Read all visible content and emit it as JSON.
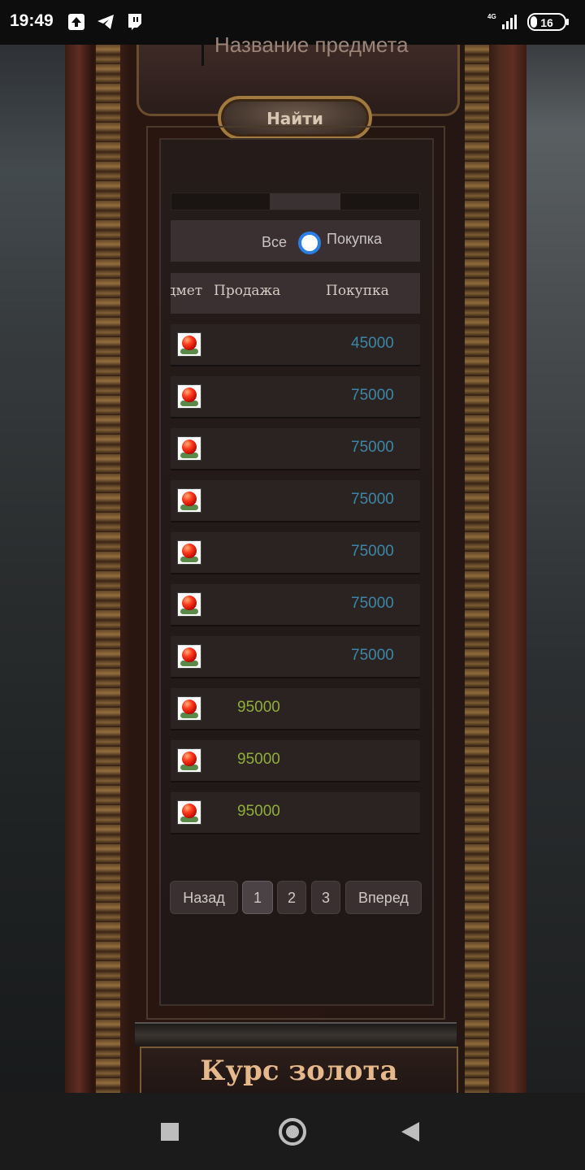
{
  "status_bar": {
    "time": "19:49",
    "network": "4G",
    "battery": "16"
  },
  "search": {
    "item_name_placeholder": "Название предмета",
    "find_button": "Найти"
  },
  "filter": {
    "all_label": "Все",
    "buy_label": "Покупка",
    "selected": "Все"
  },
  "table": {
    "headers": {
      "item": "дмет",
      "sell": "Продажа",
      "buy": "Покупка"
    },
    "rows": [
      {
        "sell": "",
        "buy": "45000"
      },
      {
        "sell": "",
        "buy": "75000"
      },
      {
        "sell": "",
        "buy": "75000"
      },
      {
        "sell": "",
        "buy": "75000"
      },
      {
        "sell": "",
        "buy": "75000"
      },
      {
        "sell": "",
        "buy": "75000"
      },
      {
        "sell": "",
        "buy": "75000"
      },
      {
        "sell": "95000",
        "buy": ""
      },
      {
        "sell": "95000",
        "buy": ""
      },
      {
        "sell": "95000",
        "buy": ""
      }
    ]
  },
  "pagination": {
    "prev": "Назад",
    "pages": [
      "1",
      "2",
      "3"
    ],
    "current": "1",
    "next": "Вперед"
  },
  "footer": {
    "title": "Курс золота"
  },
  "colors": {
    "sell_value": "#8fae3a",
    "buy_value": "#3d87a6",
    "radio_accent": "#2a7ee8"
  }
}
